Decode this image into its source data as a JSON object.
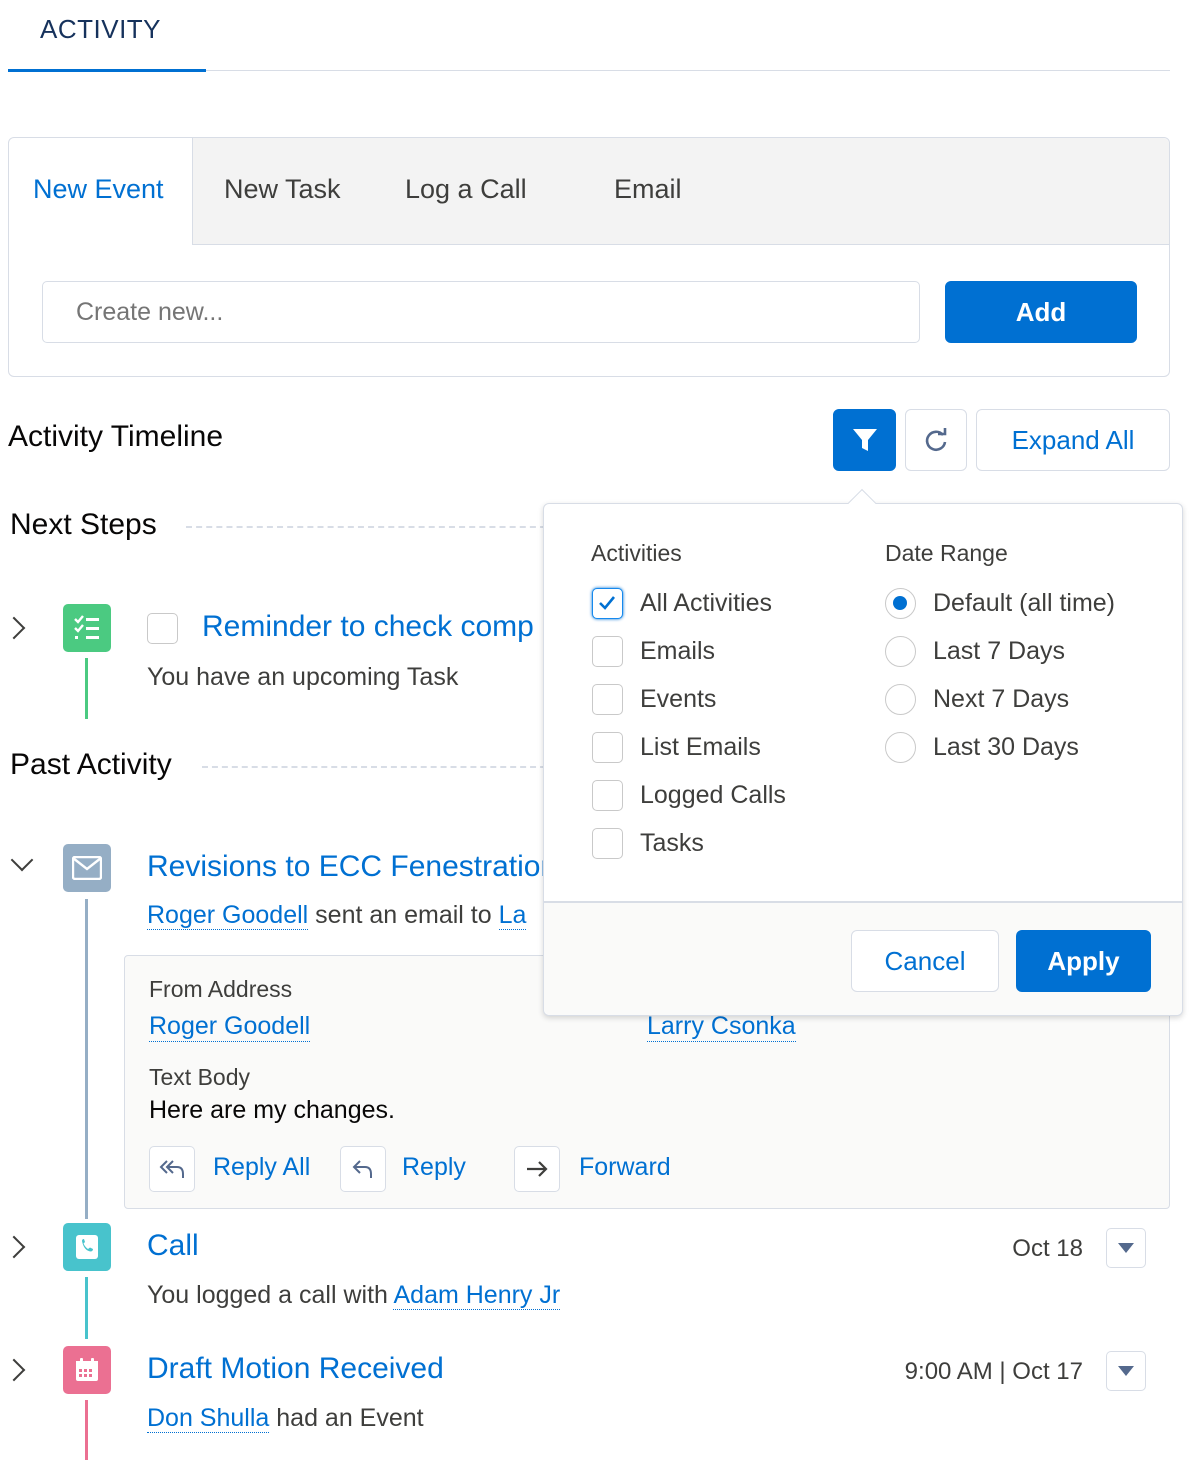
{
  "header": {
    "tab_label": "ACTIVITY"
  },
  "composer": {
    "tabs": [
      {
        "label": "New Event"
      },
      {
        "label": "New Task"
      },
      {
        "label": "Log a Call"
      },
      {
        "label": "Email"
      }
    ],
    "input_placeholder": "Create new...",
    "add_label": "Add"
  },
  "timeline": {
    "title": "Activity Timeline",
    "expand_all_label": "Expand All",
    "next_steps_label": "Next Steps",
    "past_activity_label": "Past Activity",
    "reminder": {
      "title": "Reminder to check comp",
      "subtitle": "You have an upcoming Task"
    },
    "email": {
      "title": "Revisions to ECC Fenestration",
      "sender": "Roger Goodell",
      "sent_text": " sent an email to ",
      "recipient_fragment": "La",
      "from_label": "From Address",
      "from_value": "Roger Goodell",
      "to_value": "Larry Csonka",
      "body_label": "Text Body",
      "body_value": "Here are my changes.",
      "reply_all_label": "Reply All",
      "reply_label": "Reply",
      "forward_label": "Forward"
    },
    "call": {
      "title": "Call",
      "date": "Oct 18",
      "text": "You logged a call with ",
      "contact": "Adam Henry Jr"
    },
    "event": {
      "title": "Draft Motion Received",
      "date": "9:00 AM | Oct 17",
      "contact": "Don Shulla",
      "text": " had an Event"
    }
  },
  "filter_popover": {
    "activities_label": "Activities",
    "activities": [
      {
        "label": "All Activities",
        "checked": true
      },
      {
        "label": "Emails",
        "checked": false
      },
      {
        "label": "Events",
        "checked": false
      },
      {
        "label": "List Emails",
        "checked": false
      },
      {
        "label": "Logged Calls",
        "checked": false
      },
      {
        "label": "Tasks",
        "checked": false
      }
    ],
    "date_range_label": "Date Range",
    "date_ranges": [
      {
        "label": "Default (all time)",
        "selected": true
      },
      {
        "label": "Last 7 Days",
        "selected": false
      },
      {
        "label": "Next 7 Days",
        "selected": false
      },
      {
        "label": "Last 30 Days",
        "selected": false
      }
    ],
    "cancel_label": "Cancel",
    "apply_label": "Apply"
  },
  "colors": {
    "brand": "#0070d2",
    "task_green": "#4bca81",
    "email_gray": "#95aec5",
    "call_teal": "#48c3cc",
    "event_pink": "#eb7092"
  }
}
